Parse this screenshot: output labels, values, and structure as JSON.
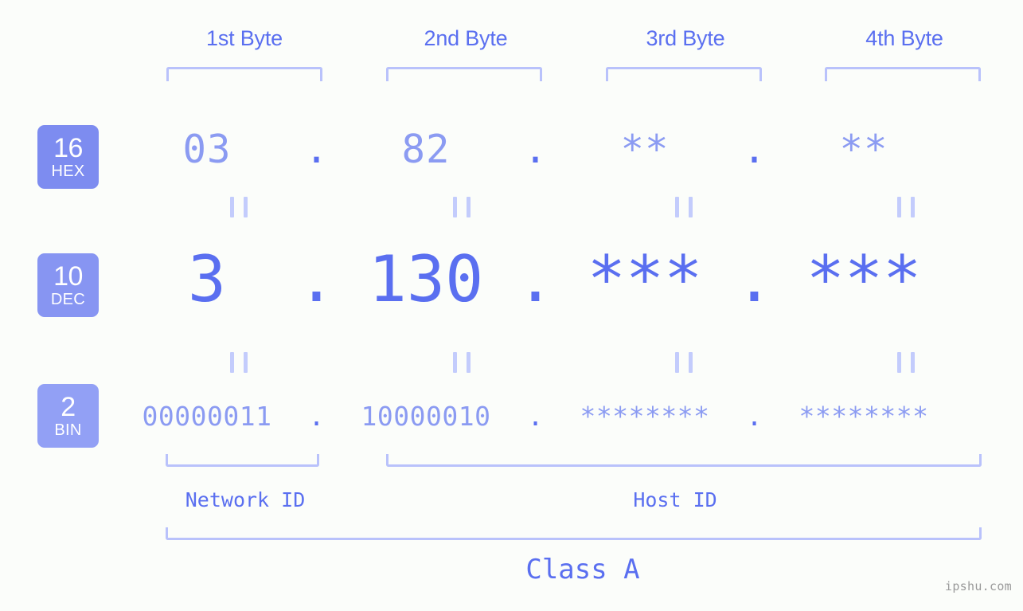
{
  "headers": {
    "bytes": [
      {
        "label": "1st Byte"
      },
      {
        "label": "2nd Byte"
      },
      {
        "label": "3rd Byte"
      },
      {
        "label": "4th Byte"
      }
    ]
  },
  "bases": [
    {
      "number": "16",
      "abbr": "HEX",
      "color": "#7d8cf0"
    },
    {
      "number": "10",
      "abbr": "DEC",
      "color": "#8795f2"
    },
    {
      "number": "2",
      "abbr": "BIN",
      "color": "#92a0f5"
    }
  ],
  "rows": {
    "hex": {
      "base_number": "16",
      "base_abbr": "HEX",
      "values": [
        "03",
        "82",
        "**",
        "**"
      ],
      "separator": "."
    },
    "dec": {
      "base_number": "10",
      "base_abbr": "DEC",
      "values": [
        "3",
        "130",
        "***",
        "***"
      ],
      "separator": "."
    },
    "bin": {
      "base_number": "2",
      "base_abbr": "BIN",
      "values": [
        "00000011",
        "10000010",
        "********",
        "********"
      ],
      "separator": "."
    }
  },
  "segments": {
    "network_id": "Network ID",
    "host_id": "Host ID",
    "class": "Class A"
  },
  "watermark": "ipshu.com",
  "colors": {
    "background": "#fbfdfa",
    "accent": "#5a6ff0",
    "accent_light": "#8b9bf2",
    "bracket": "#b9c2fb",
    "separator": "#c3ccfc",
    "watermark": "#9a9a9a"
  }
}
